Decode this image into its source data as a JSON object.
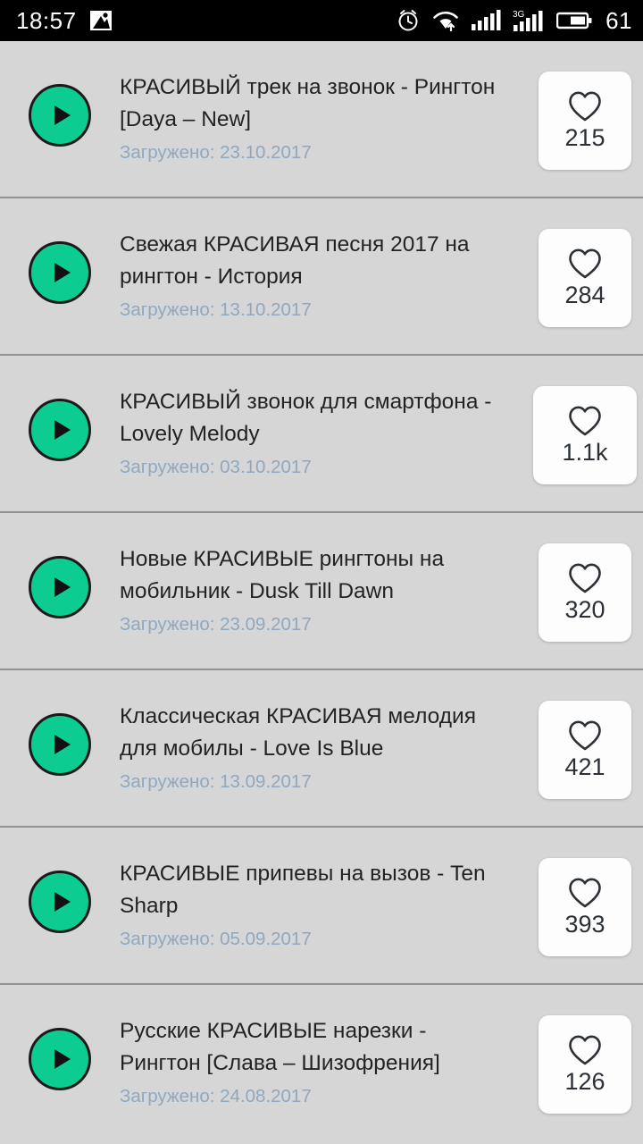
{
  "status_bar": {
    "clock": "18:57",
    "battery_level": "61",
    "icons": [
      "image-placeholder-icon",
      "alarm-clock-icon",
      "wifi-icon",
      "signal-bars-icon",
      "3g-signal-icon",
      "battery-icon"
    ],
    "network_label": "3G",
    "background_color": "#000000",
    "text_color": "#ffffff"
  },
  "theme": {
    "page_background": "#d6d6d6",
    "play_button_green": "#0ccc92",
    "title_color": "#232323",
    "date_color": "#8fa8c0",
    "card_background": "#fdfdfd",
    "divider_color": "#919191"
  },
  "list": {
    "play_icon_name": "play-icon",
    "like_icon_name": "heart-icon",
    "items": [
      {
        "title": "КРАСИВЫЙ трек на звонок - Рингтон [Daya – New]",
        "date": "Загружено: 23.10.2017",
        "likes": "215"
      },
      {
        "title": "Свежая КРАСИВАЯ песня 2017 на рингтон - История",
        "date": "Загружено: 13.10.2017",
        "likes": "284"
      },
      {
        "title": "КРАСИВЫЙ звонок для смартфона - Lovely Melody",
        "date": "Загружено: 03.10.2017",
        "likes": "1.1k"
      },
      {
        "title": "Новые КРАСИВЫЕ рингтоны на мобильник - Dusk Till Dawn",
        "date": "Загружено: 23.09.2017",
        "likes": "320"
      },
      {
        "title": "Классическая КРАСИВАЯ мелодия для мобилы - Love Is Blue",
        "date": "Загружено: 13.09.2017",
        "likes": "421"
      },
      {
        "title": "КРАСИВЫЕ припевы на вызов - Ten Sharp",
        "date": "Загружено: 05.09.2017",
        "likes": "393"
      },
      {
        "title": "Русские КРАСИВЫЕ нарезки - Рингтон [Слава – Шизофрения]",
        "date": "Загружено: 24.08.2017",
        "likes": "126"
      }
    ]
  }
}
